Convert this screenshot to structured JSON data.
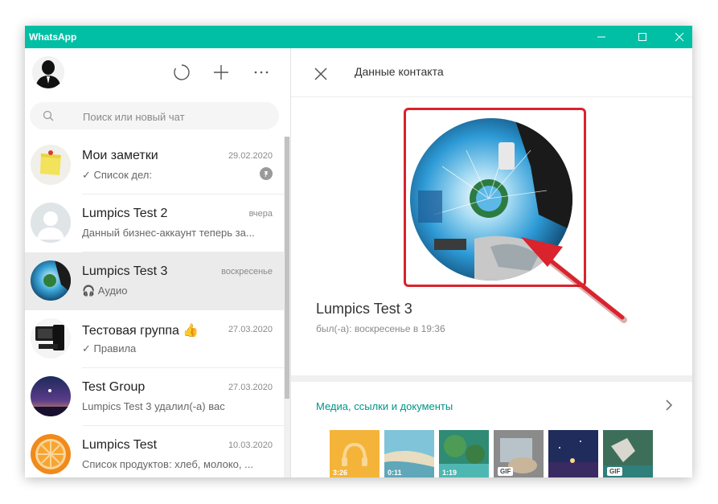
{
  "app": {
    "title": "WhatsApp"
  },
  "window_controls": {
    "minimize_icon": "minimize-icon",
    "maximize_icon": "maximize-icon",
    "close_icon": "close-icon"
  },
  "sidebar": {
    "header_icons": [
      "status-icon",
      "new-chat-icon",
      "more-icon"
    ],
    "search": {
      "placeholder": "Поиск или новый чат"
    },
    "chats": [
      {
        "name": "Мои заметки",
        "time": "29.02.2020",
        "preview": "✓ Список дел:",
        "pinned": true
      },
      {
        "name": "Lumpics Test 2",
        "time": "вчера",
        "preview": "Данный бизнес-аккаунт теперь за..."
      },
      {
        "name": "Lumpics Test 3",
        "time": "воскресенье",
        "preview": "🎧 Аудио",
        "active": true
      },
      {
        "name": "Тестовая группа 👍",
        "time": "27.03.2020",
        "preview": "✓ Правила"
      },
      {
        "name": "Test Group",
        "time": "27.03.2020",
        "preview": "Lumpics Test 3 удалил(-а) вас"
      },
      {
        "name": "Lumpics Test",
        "time": "10.03.2020",
        "preview": "Список продуктов: хлеб, молоко, ..."
      }
    ]
  },
  "contact_panel": {
    "title": "Данные контакта",
    "name": "Lumpics Test 3",
    "status": "был(-а): воскресенье в 19:36",
    "media_title": "Медиа, ссылки и документы",
    "media": [
      {
        "kind": "audio",
        "label": "3:26"
      },
      {
        "kind": "video",
        "label": "0:11"
      },
      {
        "kind": "video",
        "label": "1:19"
      },
      {
        "kind": "gif",
        "label": "GIF"
      },
      {
        "kind": "image",
        "label": ""
      },
      {
        "kind": "gif",
        "label": "GIF"
      }
    ]
  },
  "colors": {
    "accent": "#00bfa5",
    "highlight": "#d9232d",
    "link": "#009688"
  }
}
